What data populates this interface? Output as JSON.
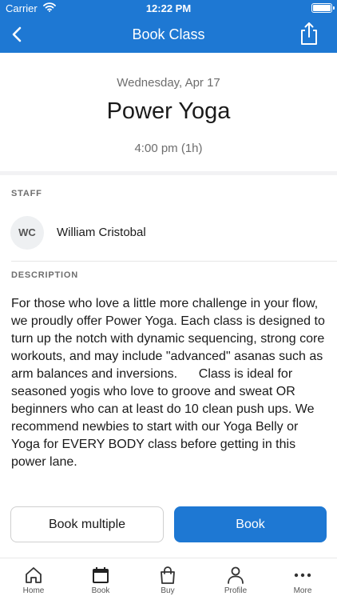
{
  "status_bar": {
    "carrier": "Carrier",
    "time": "12:22 PM"
  },
  "nav": {
    "title": "Book Class",
    "back_icon": "chevron-left-icon",
    "share_icon": "share-icon"
  },
  "class_info": {
    "date": "Wednesday, Apr 17",
    "name": "Power Yoga",
    "time": "4:00 pm (1h)"
  },
  "staff": {
    "section_label": "STAFF",
    "initials": "WC",
    "name": "William Cristobal"
  },
  "description": {
    "section_label": "DESCRIPTION",
    "text": "For those who love a little more challenge in your flow, we proudly offer Power Yoga. Each class is designed to turn up the notch with dynamic sequencing, strong core workouts, and may include \"advanced\" asanas such as arm balances and inversions.      Class is ideal for seasoned yogis who love to groove and sweat OR beginners who can at least do 10 clean push ups. We recommend newbies to start with our Yoga Belly or Yoga for EVERY BODY class before getting in this power lane."
  },
  "actions": {
    "book_multiple": "Book multiple",
    "book": "Book"
  },
  "tabs": [
    {
      "label": "Home",
      "icon": "home-icon"
    },
    {
      "label": "Book",
      "icon": "calendar-icon"
    },
    {
      "label": "Buy",
      "icon": "shopping-bag-icon"
    },
    {
      "label": "Profile",
      "icon": "person-icon"
    },
    {
      "label": "More",
      "icon": "more-dots-icon"
    }
  ],
  "colors": {
    "brand": "#1e78d3",
    "muted_text": "#6d6d6d"
  }
}
